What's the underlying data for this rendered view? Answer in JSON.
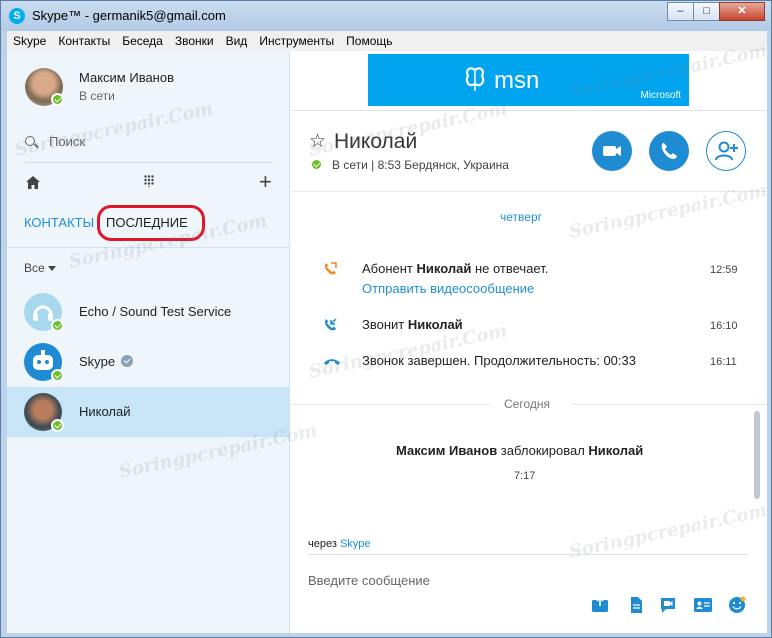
{
  "window": {
    "title": "Skype™ - germanik5@gmail.com",
    "title_icon": "skype-logo-icon",
    "controls": {
      "minimize": "–",
      "maximize": "□",
      "close": "✕"
    }
  },
  "menu": [
    "Skype",
    "Контакты",
    "Беседа",
    "Звонки",
    "Вид",
    "Инструменты",
    "Помощь"
  ],
  "profile": {
    "name": "Максим Иванов",
    "status": "В сети"
  },
  "search": {
    "label": "Поиск"
  },
  "tabs": {
    "contacts": "КОНТАКТЫ",
    "recent": "ПОСЛЕДНИЕ"
  },
  "filter": {
    "label": "Все"
  },
  "contacts": [
    {
      "name": "Echo / Sound Test Service",
      "status": "online"
    },
    {
      "name": "Skype",
      "status": "online",
      "verified": true
    },
    {
      "name": "Николай",
      "status": "online",
      "selected": true
    }
  ],
  "ad": {
    "brand": "msn",
    "company": "Microsoft"
  },
  "conversation": {
    "name": "Николай",
    "status_line": "В сети  |  8:53 Бердянск, Украина",
    "messages": [
      {
        "type": "day",
        "label": "четверг"
      },
      {
        "type": "missed",
        "text_prefix": "Абонент ",
        "bold": "Николай",
        "text_suffix": " не отвечает.",
        "link": "Отправить видеосообщение",
        "time": "12:59"
      },
      {
        "type": "incoming",
        "text_prefix": "Звонит ",
        "bold": "Николай",
        "time": "16:10"
      },
      {
        "type": "ended",
        "text": "Звонок завершен. Продолжительность: 00:33",
        "time": "16:11"
      },
      {
        "type": "day",
        "label": "Сегодня"
      }
    ],
    "blocked": {
      "actor": "Максим Иванов",
      "verb": " заблокировал ",
      "target": "Николай",
      "time": "7:17"
    },
    "via_prefix": "через ",
    "via_link": "Skype",
    "input_placeholder": "Введите сообщение"
  },
  "watermark": "Soringpcrepair.Com",
  "colors": {
    "accent": "#1e8bd2",
    "link": "#1f8fd6",
    "online": "#6cbf2b",
    "selected_row": "#c7e5f7",
    "highlight_oval": "#e0162b",
    "ad_bg": "#00a4ef"
  }
}
